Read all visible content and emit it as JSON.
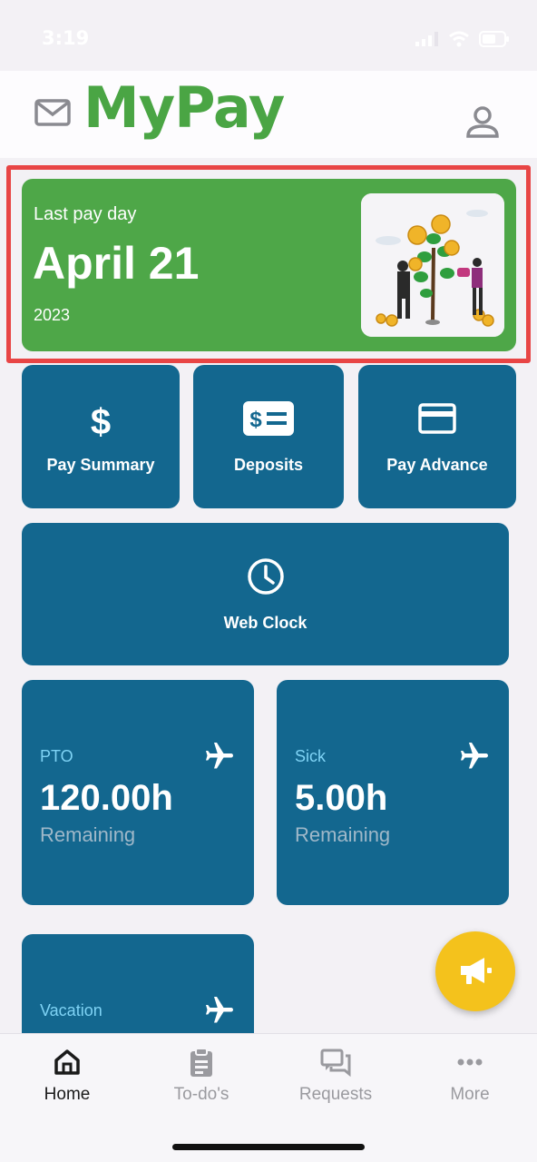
{
  "status_bar": {
    "time": "3:19"
  },
  "header": {
    "title": "MyPay"
  },
  "payday": {
    "label": "Last pay day",
    "date": "April 21",
    "year": "2023"
  },
  "quick_actions": [
    {
      "label": "Pay Summary",
      "icon": "dollar-icon"
    },
    {
      "label": "Deposits",
      "icon": "cash-bill-icon"
    },
    {
      "label": "Pay Advance",
      "icon": "credit-card-icon"
    }
  ],
  "web_clock": {
    "label": "Web Clock",
    "icon": "clock-icon"
  },
  "balances": [
    {
      "title": "PTO",
      "value": "120.00h",
      "sub": "Remaining",
      "icon": "airplane-icon"
    },
    {
      "title": "Sick",
      "value": "5.00h",
      "sub": "Remaining",
      "icon": "airplane-icon"
    },
    {
      "title": "Vacation",
      "icon": "airplane-icon"
    }
  ],
  "tabs": [
    {
      "label": "Home",
      "icon": "home-icon",
      "active": true
    },
    {
      "label": "To-do's",
      "icon": "clipboard-icon"
    },
    {
      "label": "Requests",
      "icon": "chat-icon"
    },
    {
      "label": "More",
      "icon": "more-dots-icon"
    }
  ],
  "colors": {
    "brand_green": "#4aa544",
    "tile_blue": "#13678f",
    "fab_yellow": "#f4c21c",
    "highlight_red": "#e84545"
  }
}
